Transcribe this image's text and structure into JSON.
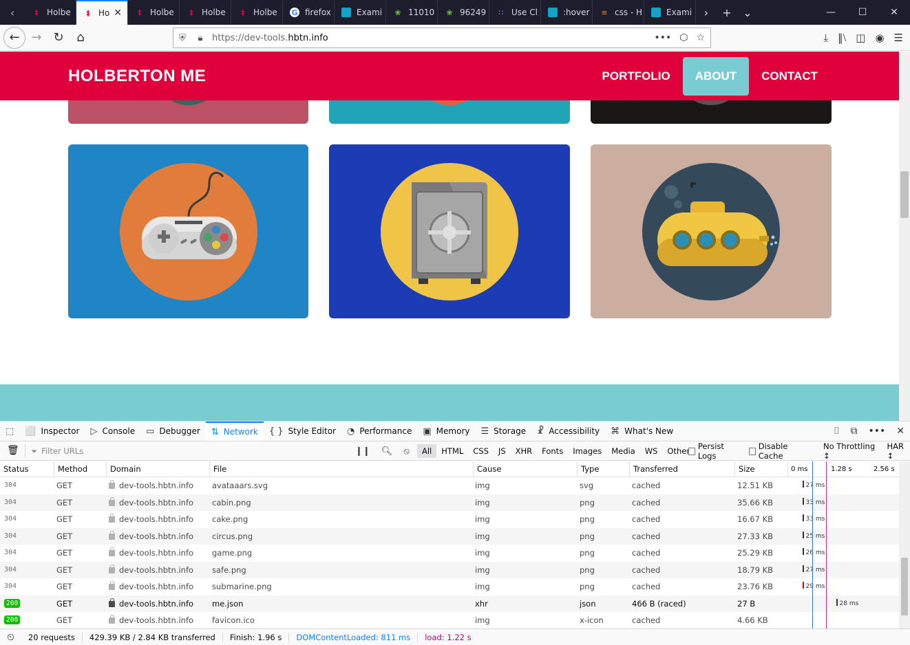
{
  "browser": {
    "tabs": [
      {
        "title": "Holbe",
        "favicon": "holberton-icon",
        "active": false
      },
      {
        "title": "Ho",
        "favicon": "holberton-icon",
        "active": true
      },
      {
        "title": "Holbe",
        "favicon": "holberton-icon",
        "active": false
      },
      {
        "title": "Holbe",
        "favicon": "holberton-icon",
        "active": false
      },
      {
        "title": "Holbe",
        "favicon": "holberton-icon",
        "active": false
      },
      {
        "title": "firefox",
        "favicon": "google-icon",
        "active": false
      },
      {
        "title": "Exami",
        "favicon": "github-icon",
        "active": false
      },
      {
        "title": "11010",
        "favicon": "bug-icon",
        "active": false
      },
      {
        "title": "96249",
        "favicon": "bug-icon",
        "active": false
      },
      {
        "title": "Use Cl",
        "favicon": "dots-icon",
        "active": false
      },
      {
        "title": ":hover",
        "favicon": "github-icon",
        "active": false
      },
      {
        "title": "css - H",
        "favicon": "stackoverflow-icon",
        "active": false
      },
      {
        "title": "Exami",
        "favicon": "github-icon",
        "active": false
      }
    ],
    "url_prefix": "https://dev-tools.",
    "url_domain": "hbtn.info"
  },
  "site": {
    "brand": "HOLBERTON ME",
    "nav": [
      {
        "label": "PORTFOLIO",
        "active": false
      },
      {
        "label": "ABOUT",
        "active": true
      },
      {
        "label": "CONTACT",
        "active": false
      }
    ],
    "colors": {
      "header": "#e0003c",
      "nav_active": "#7accd3",
      "footer_band": "#7accd3"
    }
  },
  "devtools": {
    "tabs": [
      {
        "label": "Inspector",
        "icon": "inspector-icon"
      },
      {
        "label": "Console",
        "icon": "console-icon"
      },
      {
        "label": "Debugger",
        "icon": "debugger-icon"
      },
      {
        "label": "Network",
        "icon": "network-icon",
        "active": true
      },
      {
        "label": "Style Editor",
        "icon": "style-editor-icon"
      },
      {
        "label": "Performance",
        "icon": "performance-icon"
      },
      {
        "label": "Memory",
        "icon": "memory-icon"
      },
      {
        "label": "Storage",
        "icon": "storage-icon"
      },
      {
        "label": "Accessibility",
        "icon": "accessibility-icon"
      },
      {
        "label": "What's New",
        "icon": "gift-icon"
      }
    ],
    "filter_placeholder": "Filter URLs",
    "type_filters": [
      "All",
      "HTML",
      "CSS",
      "JS",
      "XHR",
      "Fonts",
      "Images",
      "Media",
      "WS",
      "Other"
    ],
    "active_type_filter": "All",
    "persist_logs": "Persist Logs",
    "disable_cache": "Disable Cache",
    "throttling": "No Throttling ↕",
    "har": "HAR ↕",
    "columns": [
      "Status",
      "Method",
      "Domain",
      "File",
      "Cause",
      "Type",
      "Transferred",
      "Size"
    ],
    "waterfall_ticks": [
      "0 ms",
      "1.28 s",
      "2.56 s"
    ],
    "requests": [
      {
        "status": "304",
        "method": "GET",
        "domain": "dev-tools.hbtn.info",
        "file": "avataaars.svg",
        "cause": "img",
        "type": "svg",
        "transferred": "cached",
        "size": "12.51 KB",
        "timing": "27 ms"
      },
      {
        "status": "304",
        "method": "GET",
        "domain": "dev-tools.hbtn.info",
        "file": "cabin.png",
        "cause": "img",
        "type": "png",
        "transferred": "cached",
        "size": "35.66 KB",
        "timing": "33 ms"
      },
      {
        "status": "304",
        "method": "GET",
        "domain": "dev-tools.hbtn.info",
        "file": "cake.png",
        "cause": "img",
        "type": "png",
        "transferred": "cached",
        "size": "16.67 KB",
        "timing": "33 ms"
      },
      {
        "status": "304",
        "method": "GET",
        "domain": "dev-tools.hbtn.info",
        "file": "circus.png",
        "cause": "img",
        "type": "png",
        "transferred": "cached",
        "size": "27.33 KB",
        "timing": "25 ms"
      },
      {
        "status": "304",
        "method": "GET",
        "domain": "dev-tools.hbtn.info",
        "file": "game.png",
        "cause": "img",
        "type": "png",
        "transferred": "cached",
        "size": "25.29 KB",
        "timing": "26 ms"
      },
      {
        "status": "304",
        "method": "GET",
        "domain": "dev-tools.hbtn.info",
        "file": "safe.png",
        "cause": "img",
        "type": "png",
        "transferred": "cached",
        "size": "18.79 KB",
        "timing": "27 ms"
      },
      {
        "status": "304",
        "method": "GET",
        "domain": "dev-tools.hbtn.info",
        "file": "submarine.png",
        "cause": "img",
        "type": "png",
        "transferred": "cached",
        "size": "23.76 KB",
        "timing": "29 ms"
      },
      {
        "status": "200",
        "method": "GET",
        "domain": "dev-tools.hbtn.info",
        "file": "me.json",
        "cause": "xhr",
        "type": "json",
        "transferred": "466 B (raced)",
        "size": "27 B",
        "timing": "28 ms"
      },
      {
        "status": "200",
        "method": "GET",
        "domain": "dev-tools.hbtn.info",
        "file": "favicon.ico",
        "cause": "img",
        "type": "x-icon",
        "transferred": "cached",
        "size": "4.66 KB",
        "timing": ""
      }
    ],
    "summary": {
      "requests": "20 requests",
      "sizes": "429.39 KB / 2.84 KB transferred",
      "finish": "Finish: 1.96 s",
      "dcl": "DOMContentLoaded: 811 ms",
      "load": "load: 1.22 s"
    }
  }
}
